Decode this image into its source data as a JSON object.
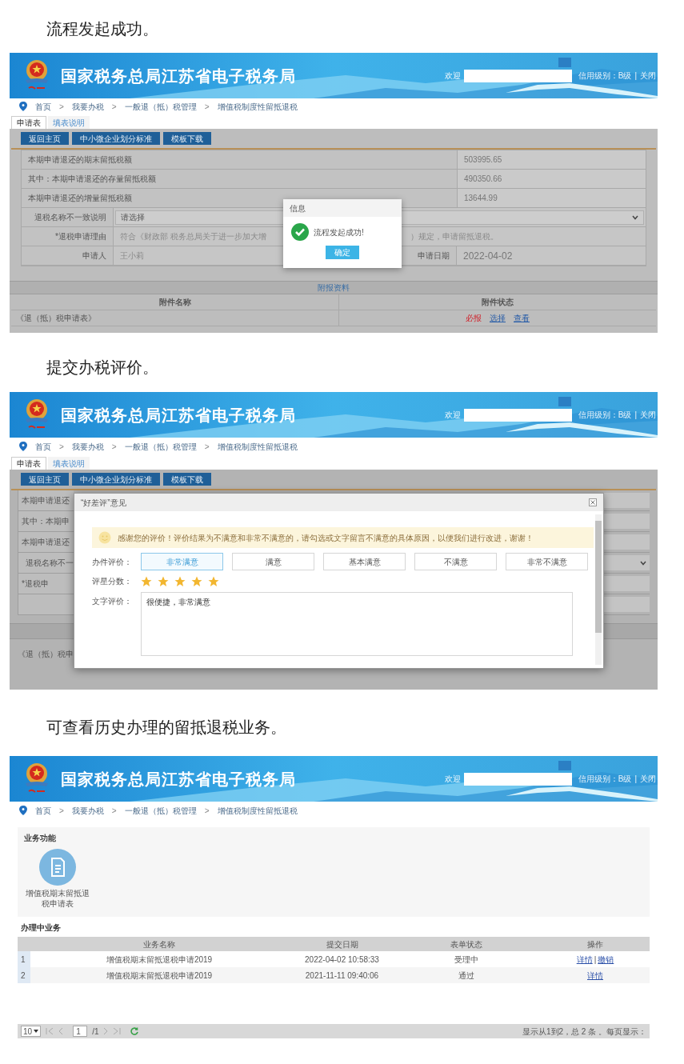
{
  "sections": [
    {
      "kind": "launch",
      "caption": "流程发起成功。",
      "header": {
        "title": "国家税务总局江苏省电子税务局",
        "welcome": "欢迎",
        "credit": "信用级别：B级",
        "separator": "|",
        "close": "关闭"
      },
      "breadcrumb": [
        "首页",
        ">",
        "我要办税",
        ">",
        "一般退（抵）税管理",
        ">",
        "增值税制度性留抵退税"
      ],
      "tabs": [
        {
          "label": "申请表",
          "selected": true
        },
        {
          "label": "填表说明",
          "selected": false
        }
      ],
      "buttons": [
        "返回主页",
        "中小微企业划分标准",
        "模板下载"
      ],
      "form_rows": [
        {
          "kind": "amount",
          "label": "本期申请退还的期末留抵税额",
          "value": "503995.65"
        },
        {
          "kind": "amount",
          "label": "其中：本期申请退还的存量留抵税额",
          "value": "490350.66"
        },
        {
          "kind": "amount",
          "label": "本期申请退还的增量留抵税额",
          "value": "13644.99"
        },
        {
          "kind": "select",
          "label": "退税名称不一致说明",
          "value": "请选择"
        },
        {
          "kind": "reason",
          "label": "*退税申请理由",
          "value_start": "符合《财政部 税务总局关于进一步加大增",
          "value_end": "）规定，申请留抵退税。"
        },
        {
          "kind": "pair",
          "label": "申请人",
          "value": "王小莉",
          "label_2": "申请日期",
          "value_2": "2022-04-02"
        }
      ],
      "attachments": {
        "title": "附报资料",
        "columns": [
          "附件名称",
          "附件状态"
        ],
        "rows": [
          {
            "name": "《退（抵）税申请表》",
            "required": "必报",
            "actions": [
              "选择",
              "查看"
            ]
          }
        ]
      },
      "dialog": {
        "title": "信息",
        "message": "流程发起成功!",
        "button": "确定"
      }
    },
    {
      "kind": "review",
      "caption": "提交办税评价。",
      "header": {
        "title": "国家税务总局江苏省电子税务局",
        "welcome": "欢迎",
        "credit": "信用级别：B级",
        "separator": "|",
        "close": "关闭"
      },
      "breadcrumb": [
        "首页",
        ">",
        "我要办税",
        ">",
        "一般退（抵）税管理",
        ">",
        "增值税制度性留抵退税"
      ],
      "tabs": [
        {
          "label": "申请表",
          "selected": true
        },
        {
          "label": "填表说明",
          "selected": false
        }
      ],
      "buttons": [
        "返回主页",
        "中小微企业划分标准",
        "模板下载"
      ],
      "background_rows": [
        {
          "kind": "field",
          "label": "本期申请退还"
        },
        {
          "kind": "field",
          "label": "其中：本期申"
        },
        {
          "kind": "field",
          "label": "本期申请退还"
        },
        {
          "kind": "select",
          "label": "退税名称不一"
        },
        {
          "kind": "field",
          "label": "*退税申"
        },
        {
          "kind": "field"
        }
      ],
      "background_attachment": "《退（抵）税申",
      "dialog": {
        "title": "“好差评”意见",
        "notice": "感谢您的评价！评价结果为不满意和非常不满意的，请勾选或文字留言不满意的具体原因，以便我们进行改进，谢谢！",
        "rating_label": "办件评价：",
        "options": [
          {
            "label": "非常满意",
            "selected": true
          },
          {
            "label": "满意",
            "selected": false
          },
          {
            "label": "基本满意",
            "selected": false
          },
          {
            "label": "不满意",
            "selected": false
          },
          {
            "label": "非常不满意",
            "selected": false
          }
        ],
        "stars_label": "评星分数：",
        "stars": 5,
        "comment_label": "文字评价：",
        "comment": "很便捷，非常满意"
      }
    },
    {
      "kind": "history",
      "caption": "可查看历史办理的留抵退税业务。",
      "header": {
        "title": "国家税务总局江苏省电子税务局",
        "welcome": "欢迎",
        "credit": "信用级别：B级",
        "separator": "|",
        "close": "关闭"
      },
      "breadcrumb": [
        "首页",
        ">",
        "我要办税",
        ">",
        "一般退（抵）税管理",
        ">",
        "增值税制度性留抵退税"
      ],
      "functions_title": "业务功能",
      "function_tile": "增值税期末留抵退税申请表",
      "in_progress_title": "办理中业务",
      "table": {
        "columns": [
          "业务名称",
          "提交日期",
          "表单状态",
          "操作"
        ],
        "action_separator": "|",
        "rows": [
          {
            "index": "1",
            "name": "增值税期末留抵退税申请2019",
            "date": "2022-04-02 10:58:33",
            "status": "受理中",
            "actions": [
              "详情",
              "撤销"
            ]
          },
          {
            "index": "2",
            "name": "增值税期末留抵退税申请2019",
            "date": "2021-11-11 09:40:06",
            "status": "通过",
            "actions": [
              "详情"
            ]
          }
        ]
      },
      "pager": {
        "page_size": "10",
        "page": "1",
        "total_pages": "/1",
        "summary": "显示从1到2，总 2 条 。每页显示："
      }
    }
  ]
}
